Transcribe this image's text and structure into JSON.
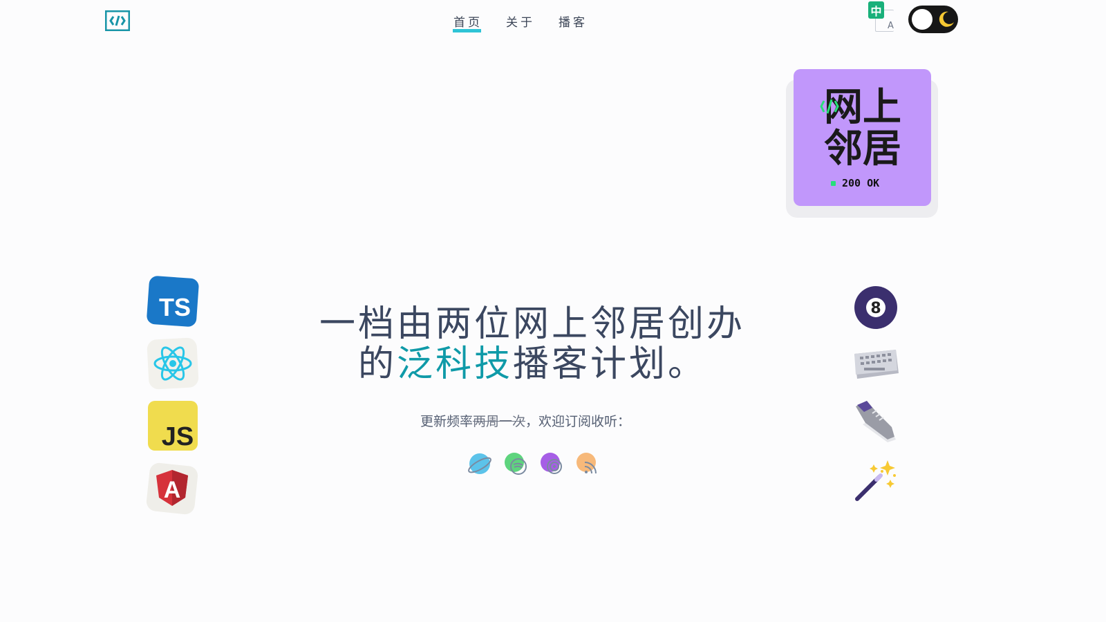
{
  "header": {
    "nav": [
      {
        "label": "首页",
        "active": true
      },
      {
        "label": "关于",
        "active": false
      },
      {
        "label": "播客",
        "active": false
      }
    ],
    "lang_toggle": {
      "primary": "中",
      "secondary": "A"
    }
  },
  "badge": {
    "title_line1": "网上",
    "title_line2": "邻居",
    "status": "200 OK"
  },
  "hero": {
    "headline_part1": "一档由两位网上邻居创办",
    "headline_part2": "的",
    "headline_highlight": "泛科技",
    "headline_part3": "播客计划。",
    "sub_prefix": "更新频率",
    "sub_strike": "两周一次",
    "sub_suffix": "，欢迎订阅收听："
  },
  "platforms": [
    "apple-podcasts-icon",
    "spotify-icon",
    "podcast-icon",
    "rss-icon"
  ],
  "left_icons": [
    {
      "name": "typescript-icon",
      "label": "TS"
    },
    {
      "name": "react-icon",
      "label": ""
    },
    {
      "name": "javascript-icon",
      "label": "JS"
    },
    {
      "name": "angular-icon",
      "label": "A"
    }
  ],
  "right_icons": [
    {
      "name": "eight-ball-icon",
      "label": "8"
    },
    {
      "name": "keyboard-icon",
      "label": ""
    },
    {
      "name": "sneaker-icon",
      "label": ""
    },
    {
      "name": "magic-wand-icon",
      "label": ""
    }
  ],
  "colors": {
    "accent": "#0f9aa8",
    "nav_underline": "#2ec4d6",
    "badge_bg": "#c197fb",
    "status_dot": "#27e07a"
  }
}
